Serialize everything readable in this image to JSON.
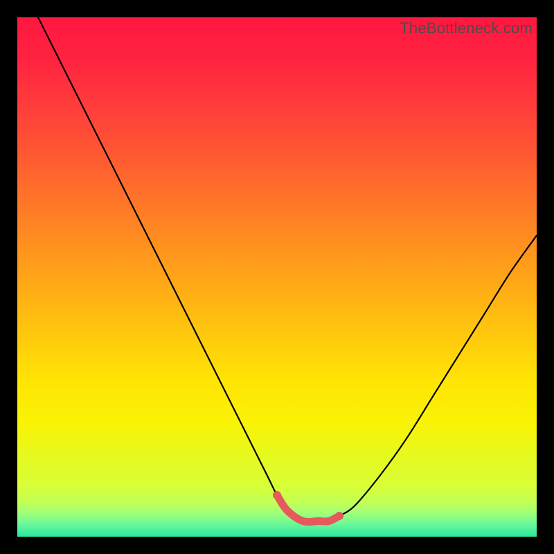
{
  "watermark": "TheBottleneck.com",
  "colors": {
    "frame": "#000000",
    "curve": "#000000",
    "highlight": "#e55a5a",
    "gradient_stops": [
      {
        "offset": 0.0,
        "color": "#ff173f"
      },
      {
        "offset": 0.08,
        "color": "#ff2340"
      },
      {
        "offset": 0.16,
        "color": "#ff3a3c"
      },
      {
        "offset": 0.25,
        "color": "#ff5433"
      },
      {
        "offset": 0.34,
        "color": "#ff712a"
      },
      {
        "offset": 0.43,
        "color": "#ff8e20"
      },
      {
        "offset": 0.52,
        "color": "#ffab16"
      },
      {
        "offset": 0.61,
        "color": "#ffc80d"
      },
      {
        "offset": 0.7,
        "color": "#ffe404"
      },
      {
        "offset": 0.78,
        "color": "#f9f305"
      },
      {
        "offset": 0.85,
        "color": "#e4fa21"
      },
      {
        "offset": 0.905,
        "color": "#d7fe39"
      },
      {
        "offset": 0.935,
        "color": "#c1ff58"
      },
      {
        "offset": 0.955,
        "color": "#a0ff79"
      },
      {
        "offset": 0.975,
        "color": "#6cf99a"
      },
      {
        "offset": 1.0,
        "color": "#29e7a0"
      }
    ]
  },
  "chart_data": {
    "type": "line",
    "title": "",
    "xlabel": "",
    "ylabel": "",
    "xlim": [
      0,
      100
    ],
    "ylim": [
      0,
      100
    ],
    "series": [
      {
        "name": "bottleneck-curve",
        "x": [
          4,
          8,
          12,
          16,
          20,
          24,
          28,
          32,
          36,
          40,
          44,
          48,
          50,
          52,
          55,
          58,
          60,
          62,
          65,
          70,
          75,
          80,
          85,
          90,
          95,
          100
        ],
        "y": [
          100,
          92,
          84,
          76,
          68,
          60,
          52,
          44,
          36,
          28,
          20,
          12,
          8,
          5,
          3,
          3,
          3,
          4,
          6,
          12,
          19,
          27,
          35,
          43,
          51,
          58
        ]
      }
    ],
    "highlight_segment": {
      "x": [
        50,
        52,
        55,
        58,
        60,
        62
      ],
      "y": [
        8,
        5,
        3,
        3,
        3,
        4
      ]
    },
    "annotations": [
      {
        "text": "TheBottleneck.com",
        "pos": "top-right"
      }
    ]
  }
}
